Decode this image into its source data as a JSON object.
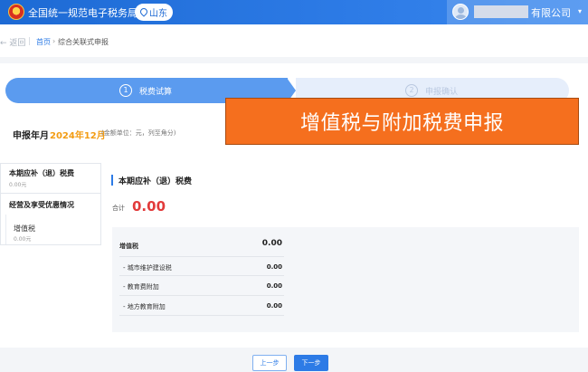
{
  "header": {
    "site_title": "全国统一规范电子税务局",
    "region": "山东",
    "company_suffix": "有限公司",
    "caret": "▾"
  },
  "breadcrumb": {
    "back": "← 返回",
    "home": "首页",
    "separator": "›",
    "current": "综合关联式申报"
  },
  "steps": [
    {
      "num": "1",
      "label": "税费试算"
    },
    {
      "num": "2",
      "label": "申报确认"
    }
  ],
  "period": {
    "label": "申报年月",
    "value": "2024年12月",
    "note": "(金额单位：元，列至角分)"
  },
  "banner": "增值税与附加税费申报",
  "leftnav": {
    "item_a": "本期应补（退）税费",
    "item_a_amount": "0.00元",
    "item_b": "经营及享受优惠情况",
    "item_c": "增值税",
    "item_c_amount": "0.00元"
  },
  "main": {
    "section_title": "本期应补（退）税费",
    "total_label": "合计",
    "total_value": "0.00",
    "rows": [
      {
        "label": "增值税",
        "value": "0.00"
      },
      {
        "label": "- 城市维护建设税",
        "value": "0.00"
      },
      {
        "label": "- 教育费附加",
        "value": "0.00"
      },
      {
        "label": "- 地方教育附加",
        "value": "0.00"
      }
    ]
  },
  "buttons": {
    "prev": "上一步",
    "next": "下一步"
  }
}
